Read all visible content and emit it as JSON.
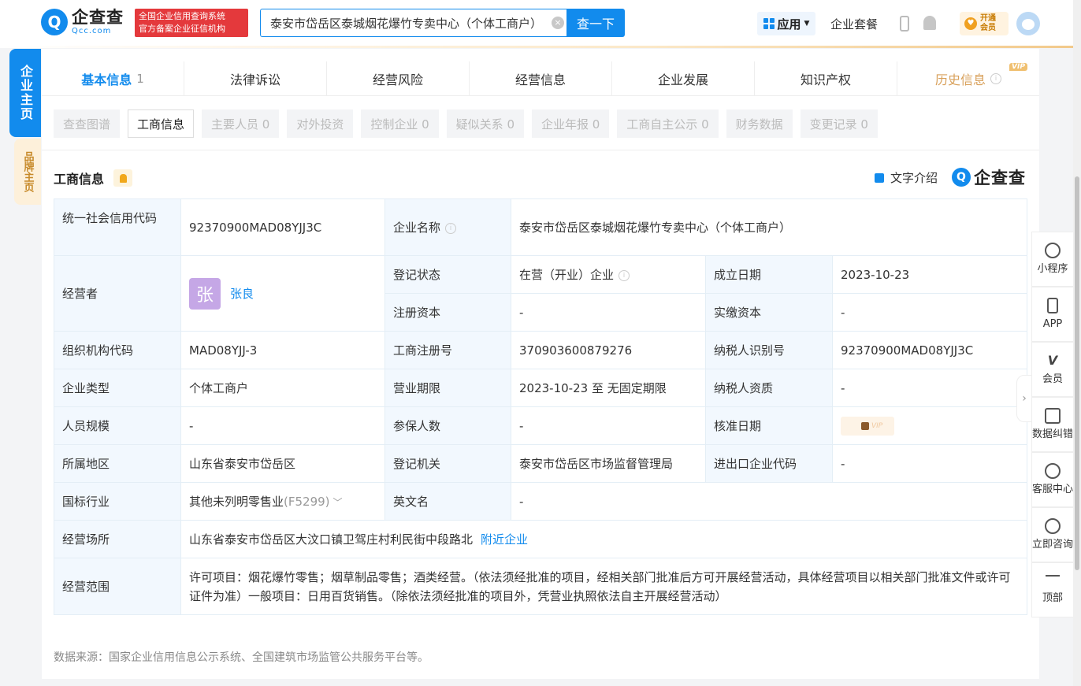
{
  "header": {
    "logo_cn": "企查查",
    "logo_en": "Qcc.com",
    "logo_glyph": "Q",
    "badge_line1": "全国企业信用查询系统",
    "badge_line2": "官方备案企业征信机构",
    "search_value": "泰安市岱岳区泰城烟花爆竹专卖中心（个体工商户）",
    "search_button": "查一下",
    "app_button": "应用",
    "suite": "企业套餐",
    "vip_line1": "开通",
    "vip_line2": "会员"
  },
  "side_tabs": {
    "main": "企业主页",
    "brand": "品牌主页"
  },
  "tabs": [
    {
      "label": "基本信息",
      "count": "1"
    },
    {
      "label": "法律诉讼"
    },
    {
      "label": "经营风险"
    },
    {
      "label": "经营信息"
    },
    {
      "label": "企业发展"
    },
    {
      "label": "知识产权"
    },
    {
      "label": "历史信息",
      "tag": "VIP"
    }
  ],
  "subtabs": [
    "查查图谱",
    "工商信息",
    "主要人员 0",
    "对外投资",
    "控制企业 0",
    "疑似关系 0",
    "企业年报 0",
    "工商自主公示 0",
    "财务数据",
    "变更记录 0"
  ],
  "section": {
    "title": "工商信息",
    "intro": "文字介绍",
    "brand": "企查查",
    "brand_glyph": "Q"
  },
  "info": {
    "credit_code_label": "统一社会信用代码",
    "credit_code": "92370900MAD08YJJ3C",
    "name_label": "企业名称",
    "name": "泰安市岱岳区泰城烟花爆竹专卖中心（个体工商户）",
    "operator_label": "经营者",
    "operator_avatar": "张",
    "operator": "张良",
    "status_label": "登记状态",
    "status": "在营（开业）企业",
    "founded_label": "成立日期",
    "founded": "2023-10-23",
    "reg_capital_label": "注册资本",
    "reg_capital": "-",
    "paid_capital_label": "实缴资本",
    "paid_capital": "-",
    "org_code_label": "组织机构代码",
    "org_code": "MAD08YJJ-3",
    "reg_no_label": "工商注册号",
    "reg_no": "370903600879276",
    "taxpayer_id_label": "纳税人识别号",
    "taxpayer_id": "92370900MAD08YJJ3C",
    "type_label": "企业类型",
    "type": "个体工商户",
    "term_label": "营业期限",
    "term": "2023-10-23 至 无固定期限",
    "taxpayer_qual_label": "纳税人资质",
    "taxpayer_qual": "-",
    "staff_label": "人员规模",
    "staff": "-",
    "insured_label": "参保人数",
    "insured": "-",
    "approved_label": "核准日期",
    "approved_vip": "VIP",
    "region_label": "所属地区",
    "region": "山东省泰安市岱岳区",
    "authority_label": "登记机关",
    "authority": "泰安市岱岳区市场监督管理局",
    "ie_code_label": "进出口企业代码",
    "ie_code": "-",
    "industry_label": "国标行业",
    "industry": "其他未列明零售业",
    "industry_code": "(F5299)",
    "en_name_label": "英文名",
    "en_name": "-",
    "address_label": "经营场所",
    "address": "山东省泰安市岱岳区大汶口镇卫驾庄村利民街中段路北",
    "nearby": "附近企业",
    "scope_label": "经营范围",
    "scope": "许可项目：烟花爆竹零售；烟草制品零售；酒类经营。（依法须经批准的项目，经相关部门批准后方可开展经营活动，具体经营项目以相关部门批准文件或许可证件为准）一般项目：日用百货销售。（除依法须经批准的项目外，凭营业执照依法自主开展经营活动）"
  },
  "source": "数据来源：国家企业信用信息公示系统、全国建筑市场监管公共服务平台等。",
  "right_bar": [
    {
      "label": "小程序",
      "icon": "miniprogram-icon"
    },
    {
      "label": "APP",
      "icon": "phone-icon"
    },
    {
      "label": "会员",
      "icon": "vip-icon",
      "glyph": "V"
    },
    {
      "label": "数据纠错",
      "icon": "edit-icon"
    },
    {
      "label": "客服中心",
      "icon": "headset-icon"
    },
    {
      "label": "立即咨询",
      "icon": "chat-icon"
    },
    {
      "label": "顶部",
      "icon": "top-icon"
    }
  ],
  "right_bar_collapse_glyph": "›"
}
